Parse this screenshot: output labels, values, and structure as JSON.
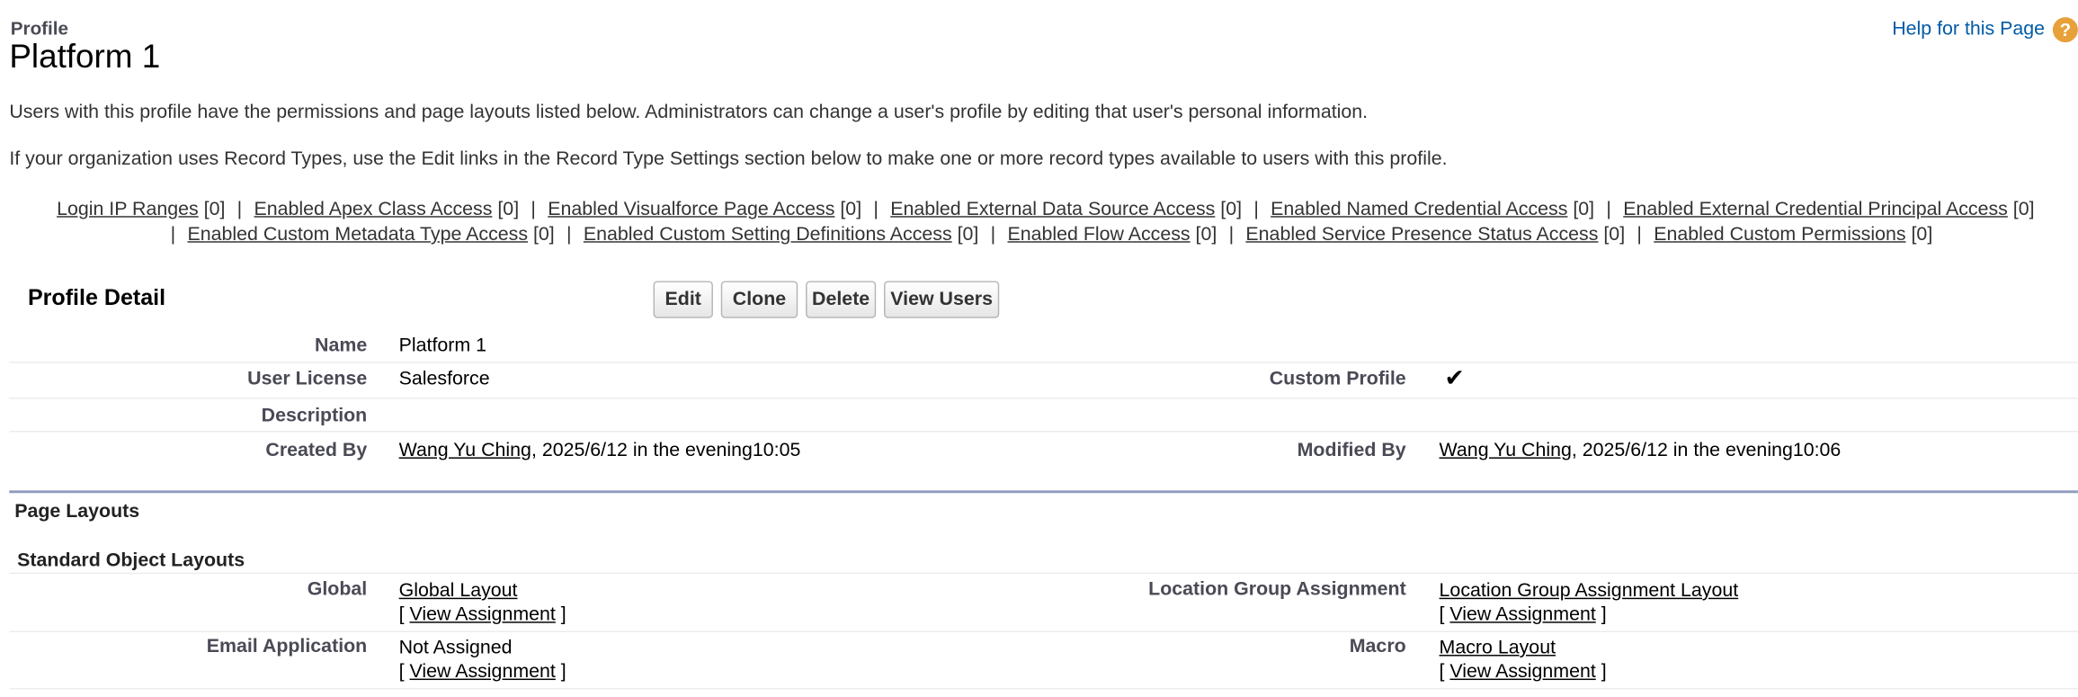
{
  "header": {
    "breadcrumb": "Profile",
    "title": "Platform 1",
    "help_link": "Help for this Page",
    "help_icon": "question-icon",
    "help_icon_glyph": "?"
  },
  "intro": {
    "line1": "Users with this profile have the permissions and page layouts listed below. Administrators can change a user's profile by editing that user's personal information.",
    "line2": "If your organization uses Record Types, use the Edit links in the Record Type Settings section below to make one or more record types available to users with this profile."
  },
  "related_links": [
    {
      "label": "Login IP Ranges",
      "count": "[0]"
    },
    {
      "label": "Enabled Apex Class Access",
      "count": "[0]"
    },
    {
      "label": "Enabled Visualforce Page Access",
      "count": "[0]"
    },
    {
      "label": "Enabled External Data Source Access",
      "count": "[0]"
    },
    {
      "label": "Enabled Named Credential Access",
      "count": "[0]"
    },
    {
      "label": "Enabled External Credential Principal Access",
      "count": "[0]"
    },
    {
      "label": "Enabled Custom Metadata Type Access",
      "count": "[0]"
    },
    {
      "label": "Enabled Custom Setting Definitions Access",
      "count": "[0]"
    },
    {
      "label": "Enabled Flow Access",
      "count": "[0]"
    },
    {
      "label": "Enabled Service Presence Status Access",
      "count": "[0]"
    },
    {
      "label": "Enabled Custom Permissions",
      "count": "[0]"
    }
  ],
  "separator": "|",
  "profile_detail": {
    "title": "Profile Detail",
    "buttons": {
      "edit": "Edit",
      "clone": "Clone",
      "delete": "Delete",
      "view_users": "View Users"
    },
    "name_label": "Name",
    "name_value": "Platform 1",
    "license_label": "User License",
    "license_value": "Salesforce",
    "custom_label": "Custom Profile",
    "custom_checked": "✔",
    "description_label": "Description",
    "created_label": "Created By",
    "created_user": "Wang Yu Ching",
    "created_time": ", 2025/6/12 in the evening10:05",
    "modified_label": "Modified By",
    "modified_user": "Wang Yu Ching",
    "modified_time": ", 2025/6/12 in the evening10:06"
  },
  "page_layouts": {
    "title": "Page Layouts",
    "subtitle": "Standard Object Layouts",
    "view_assignment": "View Assignment",
    "bracket_open": "[",
    "bracket_close": "]",
    "rows": [
      {
        "left_label": "Global",
        "left_value": "Global Layout",
        "right_label": "Location Group Assignment",
        "right_value": "Location Group Assignment Layout"
      },
      {
        "left_label": "Email Application",
        "left_value": "Not Assigned",
        "right_label": "Macro",
        "right_value": "Macro Layout"
      }
    ]
  }
}
